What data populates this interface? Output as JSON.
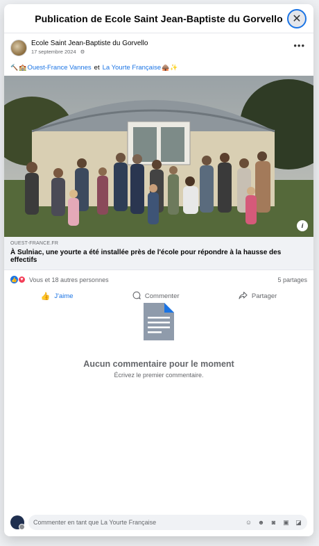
{
  "modal": {
    "title": "Publication de Ecole Saint Jean-Baptiste du Gorvello"
  },
  "post": {
    "author": "Ecole Saint Jean-Baptiste du Gorvello",
    "date": "17 septembre 2024",
    "text_mention_1": "Ouest-France Vannes",
    "text_connector": "et",
    "text_mention_2": "La Yourte Française",
    "link_domain": "OUEST-FRANCE.FR",
    "link_title": "À Sulniac, une yourte a été installée près de l'école pour répondre à la hausse des effectifs",
    "reactions_text": "Vous et 18 autres personnes",
    "shares_text": "5 partages"
  },
  "actions": {
    "like": "J'aime",
    "comment": "Commenter",
    "share": "Partager"
  },
  "empty_state": {
    "title": "Aucun commentaire pour le moment",
    "subtitle": "Écrivez le premier commentaire."
  },
  "composer": {
    "placeholder": "Commenter en tant que La Yourte Française"
  },
  "colors": {
    "accent": "#1b74e4",
    "love": "#f33e58",
    "muted_text": "#65676b"
  }
}
